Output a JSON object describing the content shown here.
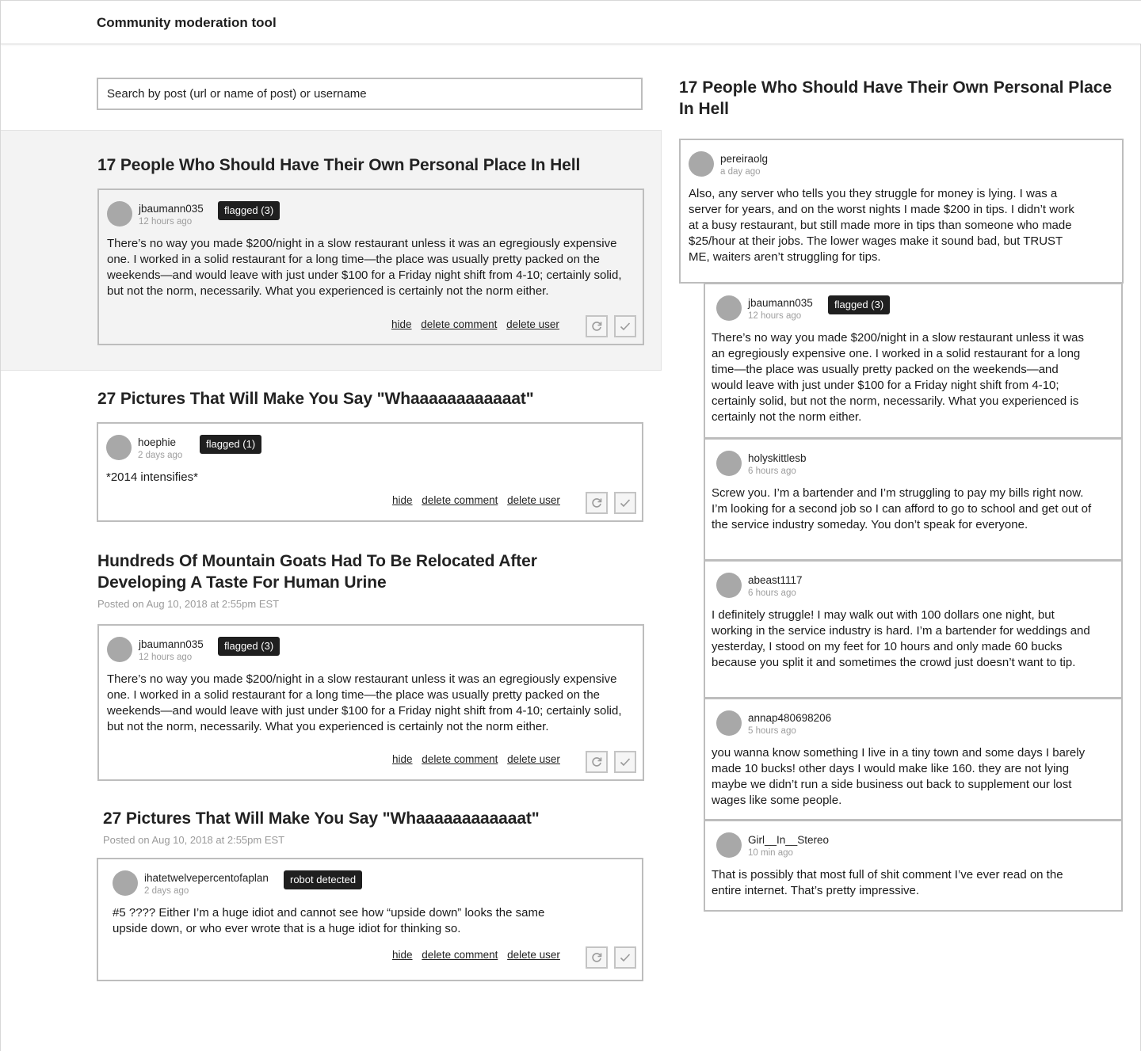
{
  "app": {
    "title": "Community moderation tool"
  },
  "search": {
    "placeholder": "Search by post (url or name of post) or username"
  },
  "actions": {
    "hide": "hide",
    "delete_comment": "delete comment",
    "delete_user": "delete user"
  },
  "posts": [
    {
      "title": "17 People Who Should Have Their Own Personal Place In Hell",
      "meta": "",
      "comment": {
        "user": "jbaumann035",
        "time": "12 hours ago",
        "badge": "flagged (3)",
        "text": "There’s no way you made $200/night in a slow restaurant unless it was an egregiously expensive one. I worked in a solid restaurant for a long time—the place was usually pretty packed on the weekends—and would leave with just under $100 for a Friday night shift from 4-10; certainly solid, but not the norm, necessarily. What you experienced is certainly not the norm either."
      }
    },
    {
      "title": "27 Pictures That Will Make You Say \"Whaaaaaaaaaaaat\"",
      "meta": "",
      "comment": {
        "user": "hoephie",
        "time": "2 days ago",
        "badge": "flagged (1)",
        "text": "*2014 intensifies*"
      }
    },
    {
      "title": "Hundreds Of Mountain Goats Had To Be Relocated After Developing A Taste For Human Urine",
      "meta": "Posted on Aug 10, 2018 at 2:55pm EST",
      "comment": {
        "user": "jbaumann035",
        "time": "12 hours ago",
        "badge": "flagged (3)",
        "text": "There’s no way you made $200/night in a slow restaurant unless it was an egregiously expensive one. I worked in a solid restaurant for a long time—the place was usually pretty packed on the weekends—and would leave with just under $100 for a Friday night shift from 4-10; certainly solid, but not the norm, necessarily. What you experienced is certainly not the norm either."
      }
    },
    {
      "title": "27 Pictures That Will Make You Say \"Whaaaaaaaaaaaat\"",
      "meta": "Posted on Aug 10, 2018 at 2:55pm EST",
      "comment": {
        "user": "ihatetwelvepercentofaplan",
        "time": "2 days ago",
        "badge": "robot detected",
        "text": "#5 ???? Either I’m a huge idiot and cannot see how “upside down” looks the same upside down, or who ever wrote that is a huge idiot for thinking so."
      }
    }
  ],
  "thread": {
    "title": "17 People Who Should Have Their Own Personal Place In Hell",
    "parent": {
      "user": "pereiraolg",
      "time": "a day ago",
      "text": "Also, any server who tells you they struggle for money is lying. I was a server for years, and on the worst nights I made $200 in tips. I didn’t work at a busy restaurant, but still made more in tips than someone who made $25/hour at their jobs. The lower wages make it sound bad, but TRUST ME, waiters aren’t struggling for tips."
    },
    "replies": [
      {
        "user": "jbaumann035",
        "time": "12 hours ago",
        "badge": "flagged (3)",
        "text": "There’s no way you made $200/night in a slow restaurant unless it was an egregiously expensive one. I worked in a solid restaurant for a long time—the place was usually pretty packed on the weekends—and would leave with just under $100 for a Friday night shift from 4-10; certainly solid, but not the norm, necessarily. What you experienced is certainly not the norm either."
      },
      {
        "user": "holyskittlesb",
        "time": "6 hours ago",
        "badge": "",
        "text": "Screw you. I’m a bartender and I’m struggling to pay my bills right now. I’m looking for a second job so I can afford to go to school and get out of the service industry someday. You don’t speak for everyone."
      },
      {
        "user": "abeast1117",
        "time": "6 hours ago",
        "badge": "",
        "text": "I definitely struggle! I may walk out with 100 dollars one night, but working in the service industry is hard. I’m a bartender for weddings and yesterday, I stood on my feet for 10 hours and only made 60 bucks because you split it and sometimes the crowd just doesn’t want to tip."
      },
      {
        "user": "annap480698206",
        "time": "5 hours ago",
        "badge": "",
        "text": "you wanna know something I live in a tiny town and some days I barely made 10 bucks! other days I would make like 160. they are not lying maybe we didn’t run a side business out back to supplement our lost wages like some people."
      },
      {
        "user": "Girl__In__Stereo",
        "time": "10 min ago",
        "badge": "",
        "text": "That is possibly that most full of shit comment I’ve ever read on the entire internet. That’s pretty impressive."
      }
    ]
  }
}
